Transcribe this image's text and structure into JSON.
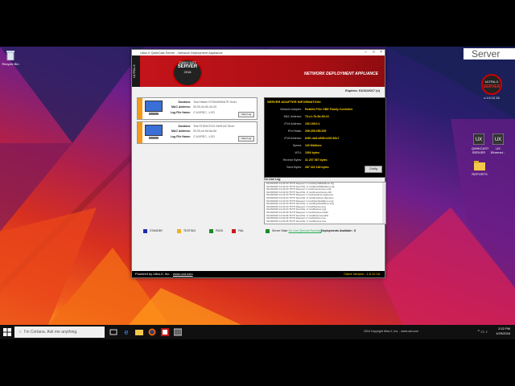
{
  "desktop": {
    "recycle_bin": "Recycle Bin",
    "server_label": "Server",
    "server_logo": {
      "line1": "ULTRA-X",
      "line2": "SERVER",
      "version": "v.1.6.12.16"
    },
    "icons": [
      {
        "label": "QWIKCAST\nSERVER"
      },
      {
        "label": "UX Ethernet..."
      },
      {
        "label": "REPORTS"
      }
    ]
  },
  "app": {
    "window_title": "Ultra-X QwikCast Server - Network Deployment Appliance",
    "side_text": "ULTRA-X",
    "logo": {
      "top": "QWIKCAST",
      "main": "SERVER",
      "sub": "2016"
    },
    "appliance_title": "NETWORK DEPLOYMENT APPLIANCE",
    "expires": "Expires: 01/31/2017 (v)",
    "devices": [
      {
        "duration_label": "Duration:",
        "duration_value": "Test Hitachi HTS545050A7E Short",
        "mac_label": "MAC Address:",
        "mac_value": "00-00-0e-50-40-00",
        "logfile_label": "Log File Name:",
        "logfile_value": "C:\\UXREC...LOG",
        "view_log": "View Log"
      },
      {
        "duration_label": "Duration:",
        "duration_value": "Test ST500LT012-9WS142 Short",
        "mac_label": "MAC Address:",
        "mac_value": "00-00-ee-5d-5a-5e",
        "logfile_label": "Log File Name:",
        "logfile_value": "C:\\UXREC...LOG",
        "view_log": "View Log"
      }
    ],
    "adapter": {
      "header": "SERVER ADAPTER INFORMATION:",
      "rows": [
        {
          "k": "Network Adapter:",
          "v": "Realtek PCIe GBE Family Controller"
        },
        {
          "k": "MAC Address:",
          "v": "70-c1-7b-5b-59-19"
        },
        {
          "k": "IPv4 Address:",
          "v": "192.168.0.1"
        },
        {
          "k": "IPv4 Mask:",
          "v": "255.255.255.255"
        },
        {
          "k": "IPv6 Address:",
          "v": "fe80::ad4:d396:c202:60c7"
        },
        {
          "k": "Speed:",
          "v": "100 Mbit/sec"
        },
        {
          "k": "MTU:",
          "v": "1500 bytes"
        },
        {
          "k": "Receive Bytes:",
          "v": "31 207 367 bytes"
        },
        {
          "k": "Send Bytes:",
          "v": "287 322 163 bytes"
        }
      ],
      "config_button": "Config"
    },
    "log_label": "On Line Log",
    "log_lines": [
      "01/29/2016 14:22:04 TFTP Request: C:\\uxd\\bcp\\WMeMenu.cfg",
      "01/29/2016 14:22:04 TFTP Send file: C:\\uxd\\bcp\\WMeMenu.cfg",
      "01/29/2016 14:22:04 TFTP Request: C:\\uxd\\menu\\menu.c32",
      "01/29/2016 14:22:04 TFTP Send file: C:\\uxd\\menu\\menu.c32",
      "01/29/2016 14:22:04 TFTP Request: C:\\uxd\\pxelinux.cfg\\menu",
      "01/29/2016 14:22:04 TFTP Send file: C:\\uxd\\pxelinux.cfg\\menu",
      "01/29/2016 14:22:04 TFTP Request: C:\\uxd\\bcp\\SubMenu.png",
      "01/29/2016 14:22:04 TFTP Send file: C:\\uxd\\bcp\\SubMenu.png",
      "01/29/2016 14:22:04 TFTP Request: C:\\uxd\\bcp\\ux.png",
      "01/29/2016 14:22:04 TFTP Send file: C:\\uxd\\bcp\\ux.png",
      "01/29/2016 14:22:06 TFTP Request: C:\\uxd\\bcp\\memdisk",
      "01/29/2016 14:22:06 TFTP Send file: C:\\uxd\\bcp\\memdisk",
      "01/29/2016 14:22:06 TFTP Request: C:\\uxd\\bcp\\ux.ima",
      "01/29/2016 14:22:06 TFTP Send file: C:\\uxd\\bcp\\ux.ima"
    ],
    "legend": [
      {
        "label": "STANDBY",
        "color": "#1a2fb0"
      },
      {
        "label": "TESTING",
        "color": "#f0b020"
      },
      {
        "label": "PASS",
        "color": "#1a8a2a"
      },
      {
        "label": "FAIL",
        "color": "#d01818"
      }
    ],
    "server_state": {
      "label": "Server State",
      "link": "On Line (Service Running)",
      "color": "#1a8a2a"
    },
    "deployments": "Deployments Available : 8",
    "status_left": "Powered by Ultra-X, Inc. - ",
    "status_link": "www.uxd.com",
    "client_version": "Client Version : 1.6.12.16"
  },
  "taskbar": {
    "search_placeholder": "I'm Cortana. Ask me anything.",
    "copyright": "2016 Copyright Ultra-X, Inc. - www.uxd.com",
    "time": "2:22 PM",
    "date": "1/29/2016"
  }
}
